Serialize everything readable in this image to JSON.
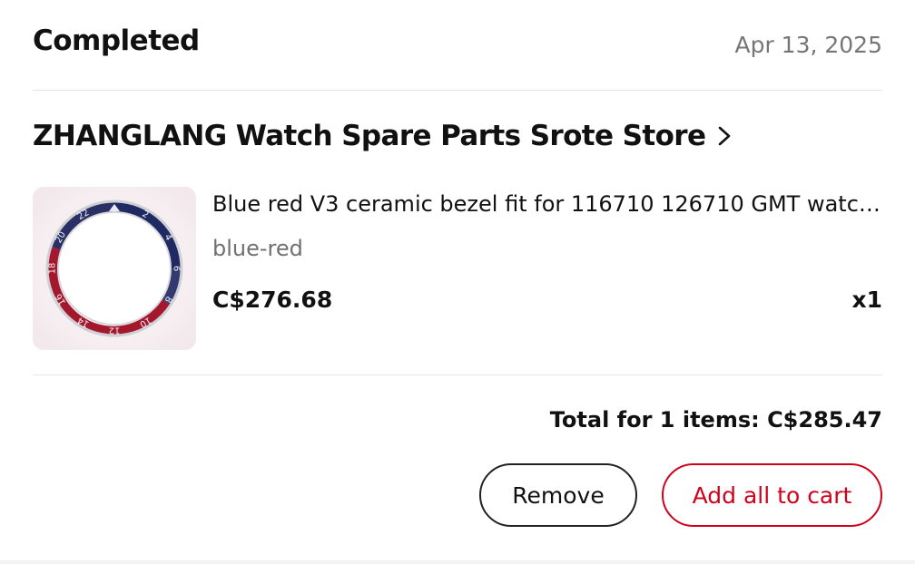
{
  "order": {
    "status": "Completed",
    "date": "Apr 13, 2025"
  },
  "store": {
    "name": "ZHANGLANG Watch Spare Parts Srote Store",
    "chevron_icon": "chevron-right-icon"
  },
  "item": {
    "title": "Blue red V3  ceramic bezel fit for 116710 126710 GMT watch …",
    "variant": "blue-red",
    "price": "C$276.68",
    "quantity": "x1",
    "image": {
      "description_icon": "watch-bezel-image",
      "bezel_numbers": [
        "2",
        "4",
        "6",
        "8",
        "10",
        "12",
        "14",
        "16",
        "18",
        "20",
        "22"
      ]
    }
  },
  "summary": {
    "total_label": "Total for 1 items: C$285.47"
  },
  "actions": {
    "remove_label": "Remove",
    "add_all_label": "Add all to cart"
  },
  "colors": {
    "accent": "#d0021b",
    "text_primary": "#111111",
    "text_secondary": "#707070",
    "divider": "#e6e6e6",
    "bezel_blue": "#1f2a63",
    "bezel_red": "#a3182c"
  }
}
